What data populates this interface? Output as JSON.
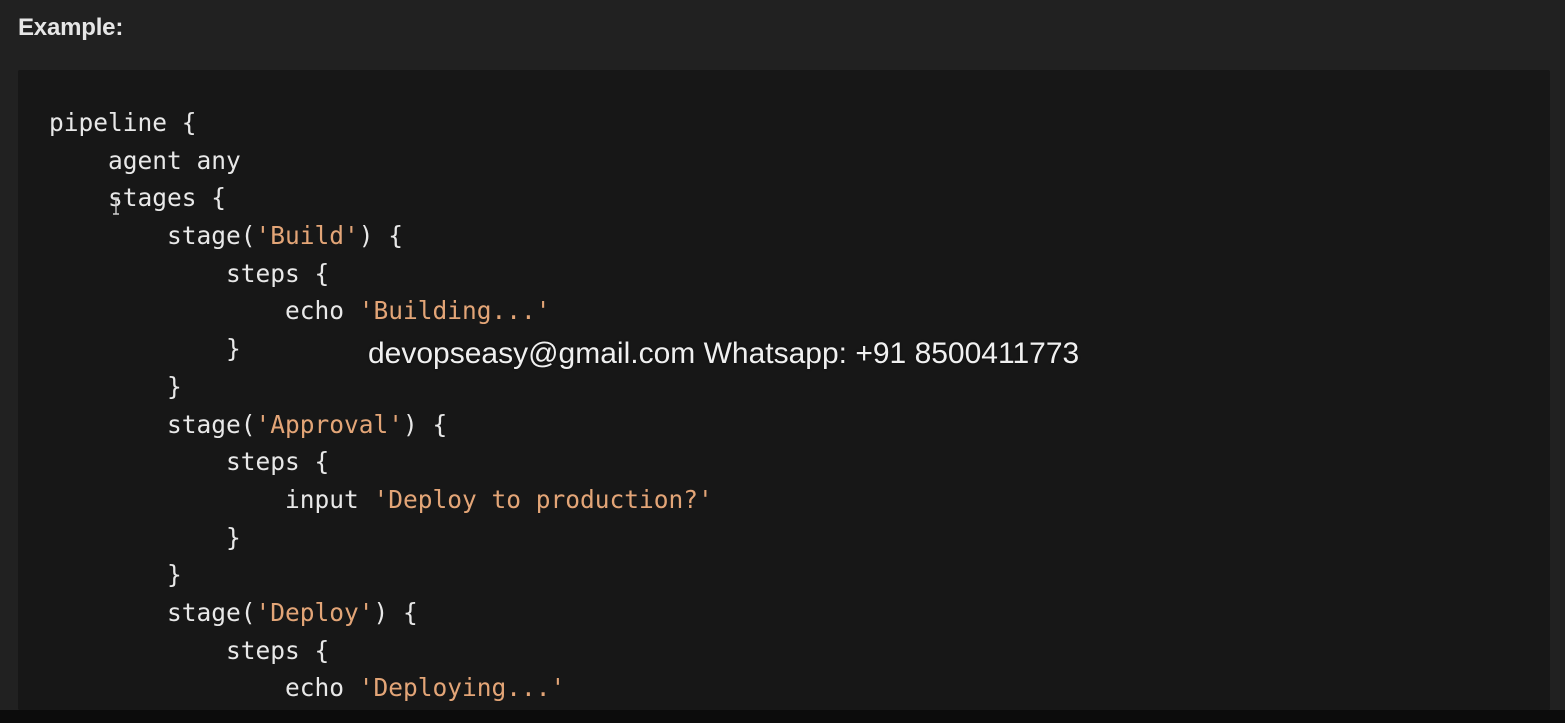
{
  "heading": "Example:",
  "code_lines": [
    [
      {
        "t": "pipeline {"
      }
    ],
    [
      {
        "t": "    agent any"
      }
    ],
    [
      {
        "t": "    stages {"
      }
    ],
    [
      {
        "t": "        stage("
      },
      {
        "t": "'Build'",
        "s": 1
      },
      {
        "t": ") {"
      }
    ],
    [
      {
        "t": "            steps {"
      }
    ],
    [
      {
        "t": "                echo "
      },
      {
        "t": "'Building...'",
        "s": 1
      }
    ],
    [
      {
        "t": "            }"
      }
    ],
    [
      {
        "t": "        }"
      }
    ],
    [
      {
        "t": "        stage("
      },
      {
        "t": "'Approval'",
        "s": 1
      },
      {
        "t": ") {"
      }
    ],
    [
      {
        "t": "            steps {"
      }
    ],
    [
      {
        "t": "                input "
      },
      {
        "t": "'Deploy to production?'",
        "s": 1
      }
    ],
    [
      {
        "t": "            }"
      }
    ],
    [
      {
        "t": "        }"
      }
    ],
    [
      {
        "t": "        stage("
      },
      {
        "t": "'Deploy'",
        "s": 1
      },
      {
        "t": ") {"
      }
    ],
    [
      {
        "t": "            steps {"
      }
    ],
    [
      {
        "t": "                echo "
      },
      {
        "t": "'Deploying...'",
        "s": 1
      }
    ]
  ],
  "watermark": "devopseasy@gmail.com Whatsapp: +91 8500411773",
  "colors": {
    "background": "#212121",
    "code_background": "#171717",
    "code_text": "#e8e8e8",
    "string": "#e3a577",
    "heading": "#e6e6e6"
  },
  "icons": {
    "cursor": "text-cursor-icon"
  }
}
